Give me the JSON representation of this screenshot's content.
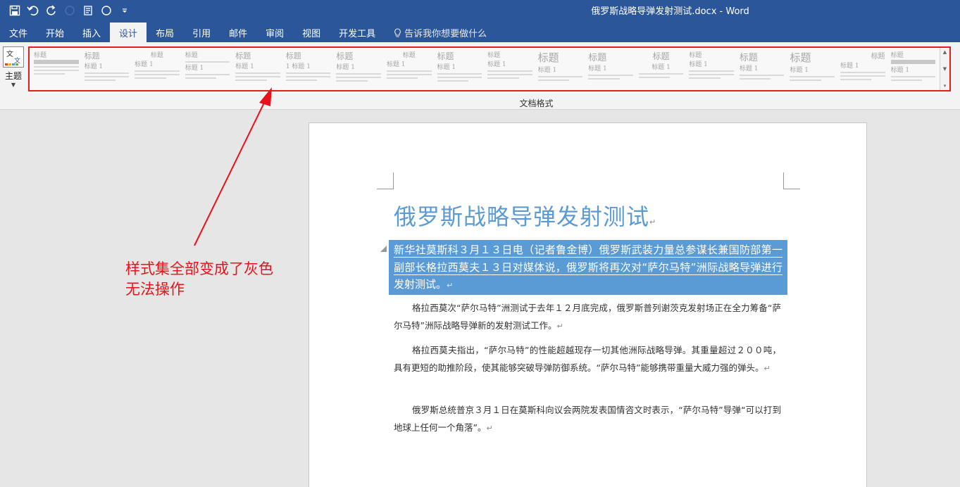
{
  "window": {
    "title": "俄罗斯战略导弹发射测试.docx  -  Word"
  },
  "qat": {
    "icons": [
      "save-icon",
      "undo-icon",
      "redo-icon",
      "circle-icon",
      "touch-mode-icon",
      "circle-icon",
      "customize-icon"
    ]
  },
  "tabs": [
    {
      "label": "文件",
      "active": false
    },
    {
      "label": "开始",
      "active": false
    },
    {
      "label": "插入",
      "active": false
    },
    {
      "label": "设计",
      "active": true
    },
    {
      "label": "布局",
      "active": false
    },
    {
      "label": "引用",
      "active": false
    },
    {
      "label": "邮件",
      "active": false
    },
    {
      "label": "审阅",
      "active": false
    },
    {
      "label": "视图",
      "active": false
    },
    {
      "label": "开发工具",
      "active": false
    }
  ],
  "tell_me": {
    "label": "告诉我你想要做什么"
  },
  "ribbon": {
    "theme_label": "主题",
    "group_label": "文档格式",
    "styles": [
      {
        "title": "标题",
        "sub": ""
      },
      {
        "title": "标题",
        "sub": "标题 1"
      },
      {
        "title": "标题",
        "sub": "标题 1"
      },
      {
        "title": "标题",
        "sub": "标题 1"
      },
      {
        "title": "标题",
        "sub": "标题 1"
      },
      {
        "title": "标题",
        "sub": "1 标题 1"
      },
      {
        "title": "标题",
        "sub": "标题 1"
      },
      {
        "title": "标题",
        "sub": "标题 1"
      },
      {
        "title": "标题",
        "sub": "标题 1"
      },
      {
        "title": "标题",
        "sub": "标题 1"
      },
      {
        "title": "标题",
        "sub": "标题 1"
      },
      {
        "title": "标题",
        "sub": "标题 1"
      },
      {
        "title": "标题",
        "sub": "标题 1"
      },
      {
        "title": "标题",
        "sub": "标题 1"
      },
      {
        "title": "标题",
        "sub": "标题 1"
      },
      {
        "title": "标题",
        "sub": "标题 1"
      },
      {
        "title": "标题",
        "sub": "标题 1"
      },
      {
        "title": "标题",
        "sub": "标题 1"
      }
    ]
  },
  "document": {
    "heading": "俄罗斯战略导弹发射测试",
    "selected_paragraph": "新华社莫斯科３月１３日电（记者鲁金博）俄罗斯武装力量总参谋长兼国防部第一副部长格拉西莫夫１３日对媒体说，俄罗斯将再次对“萨尔马特”洲际战略导弹进行发射测试。",
    "paragraphs": [
      "格拉西莫次“萨尔马特”洲测试于去年１２月底完成，俄罗斯普列谢茨克发射场正在全力筹备“萨尔马特”洲际战略导弹新的发射测试工作。",
      "格拉西莫夫指出，“萨尔马特”的性能超越现存一切其他洲际战略导弹。其重量超过２００吨，具有更短的助推阶段，使其能够突破导弹防御系统。“萨尔马特”能够携带重量大威力强的弹头。",
      "俄罗斯总统普京３月１日在莫斯科向议会两院发表国情咨文时表示，“萨尔马特”导弹“可以打到地球上任何一个角落”。"
    ]
  },
  "annotation": {
    "line1": "样式集全部变成了灰色",
    "line2": "无法操作",
    "color": "#e8131a"
  },
  "colors": {
    "brand": "#2b579a",
    "heading": "#5b9bd5",
    "selection": "#5b9bd5"
  }
}
